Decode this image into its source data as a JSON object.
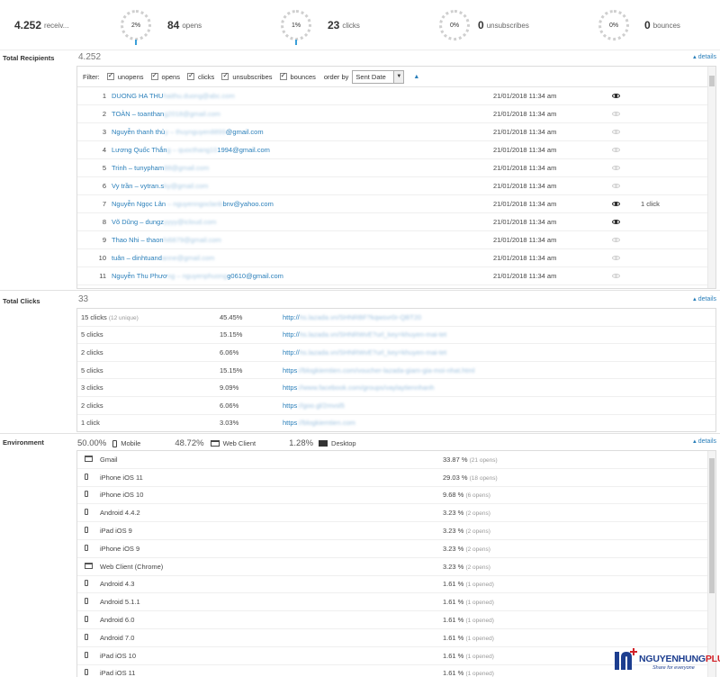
{
  "stats": {
    "receivers": {
      "value": "4.252",
      "label": "receiv..."
    },
    "opens": {
      "gauge": "2%",
      "value": "84",
      "label": "opens"
    },
    "clicks": {
      "gauge": "1%",
      "value": "23",
      "label": "clicks"
    },
    "unsubscribes": {
      "gauge": "0%",
      "value": "0",
      "label": "unsubscribes"
    },
    "bounces": {
      "gauge": "0%",
      "value": "0",
      "label": "bounces"
    }
  },
  "details_label": "details",
  "recipients": {
    "title": "Total Recipients",
    "count": "4.252",
    "filter_label": "Filter:",
    "filters": [
      "unopens",
      "opens",
      "clicks",
      "unsubscribes",
      "bounces"
    ],
    "order_by_label": "order by",
    "order_by_value": "Sent Date",
    "rows": [
      {
        "num": "1",
        "name": "DUONG HA THU",
        "email_hidden": "haithu.duong@abc.com",
        "email_visible": "",
        "date": "21/01/2018 11:34 am",
        "opened": true,
        "clicks": ""
      },
      {
        "num": "2",
        "name": "TOÀN – toanthan",
        "email_hidden": "g2018@gmail.com",
        "email_visible": "",
        "date": "21/01/2018 11:34 am",
        "opened": false,
        "clicks": ""
      },
      {
        "num": "3",
        "name": "Nguyễn thanh thủ",
        "email_hidden": "y – thuynguyen8899",
        "email_visible": "@gmail.com",
        "date": "21/01/2018 11:34 am",
        "opened": false,
        "clicks": ""
      },
      {
        "num": "4",
        "name": "Lương Quốc Thắn",
        "email_hidden": "g – quocthang10",
        "email_visible": "1994@gmail.com",
        "date": "21/01/2018 11:34 am",
        "opened": false,
        "clicks": ""
      },
      {
        "num": "5",
        "name": "Trinh – tunypham",
        "email_hidden": "88@gmail.com",
        "email_visible": "",
        "date": "21/01/2018 11:34 am",
        "opened": false,
        "clicks": ""
      },
      {
        "num": "6",
        "name": "Vy trần – vytran.s",
        "email_hidden": "ky@gmail.com",
        "email_visible": "",
        "date": "21/01/2018 11:34 am",
        "opened": false,
        "clicks": ""
      },
      {
        "num": "7",
        "name": "Nguyễn Ngọc Lân",
        "email_hidden": " – nguyenngoclanb",
        "email_visible": "bnv@yahoo.com",
        "date": "21/01/2018 11:34 am",
        "opened": true,
        "clicks": "1 click"
      },
      {
        "num": "8",
        "name": "Võ Dũng – dungz",
        "email_hidden": "yyyy@icloud.com",
        "email_visible": "",
        "date": "21/01/2018 11:34 am",
        "opened": true,
        "clicks": ""
      },
      {
        "num": "9",
        "name": "Thao Nhi – thaon",
        "email_hidden": "hi6879@gmail.com",
        "email_visible": "",
        "date": "21/01/2018 11:34 am",
        "opened": false,
        "clicks": ""
      },
      {
        "num": "10",
        "name": "tuân – dinhtuand",
        "email_hidden": "anne@gmail.com",
        "email_visible": "",
        "date": "21/01/2018 11:34 am",
        "opened": false,
        "clicks": ""
      },
      {
        "num": "11",
        "name": "Nguyễn Thu Phươ",
        "email_hidden": "ng – nguyenphuong",
        "email_visible": "g0610@gmail.com",
        "date": "21/01/2018 11:34 am",
        "opened": false,
        "clicks": ""
      }
    ]
  },
  "total_clicks": {
    "title": "Total Clicks",
    "count": "33",
    "rows": [
      {
        "clicks": "15 clicks",
        "unique": "(12 unique)",
        "pct": "45.45%",
        "url_visible": "http://",
        "url_hidden": "hs.lazada.vn/SHNRBF?kqwsvr0r-QBT20"
      },
      {
        "clicks": "5 clicks",
        "unique": "",
        "pct": "15.15%",
        "url_visible": "http://",
        "url_hidden": "hs.lazada.vn/SHNRWvE?url_key=khuyen-mai-tet"
      },
      {
        "clicks": "2 clicks",
        "unique": "",
        "pct": "6.06%",
        "url_visible": "http://",
        "url_hidden": "hs.lazada.vn/SHNRWvE?url_key=khuyen-mai-tet"
      },
      {
        "clicks": "5 clicks",
        "unique": "",
        "pct": "15.15%",
        "url_visible": "https",
        "url_hidden": "://blogkiemtien.com/voucher-lazada-giam-gia-moi-nhat.html"
      },
      {
        "clicks": "3 clicks",
        "unique": "",
        "pct": "9.09%",
        "url_visible": "https",
        "url_hidden": "://www.facebook.com/groups/vaylaytiennhanh"
      },
      {
        "clicks": "2 clicks",
        "unique": "",
        "pct": "6.06%",
        "url_visible": "https",
        "url_hidden": "://goo.gl/2mvsl5"
      },
      {
        "clicks": "1 click",
        "unique": "",
        "pct": "3.03%",
        "url_visible": "https",
        "url_hidden": "://blogkiemtien.com"
      }
    ]
  },
  "environment": {
    "title": "Environment",
    "summary": [
      {
        "pct": "50.00%",
        "label": "Mobile",
        "icon": "mobile-icon"
      },
      {
        "pct": "48.72%",
        "label": "Web Client",
        "icon": "window-icon"
      },
      {
        "pct": "1.28%",
        "label": "Desktop",
        "icon": "desktop-icon"
      }
    ],
    "rows": [
      {
        "icon": "window",
        "name": "Gmail",
        "pct": "33.87 %",
        "opens": "(21 opens)"
      },
      {
        "icon": "phone",
        "name": "iPhone iOS 11",
        "pct": "29.03 %",
        "opens": "(18 opens)"
      },
      {
        "icon": "phone",
        "name": "iPhone iOS 10",
        "pct": "9.68 %",
        "opens": "(6 opens)"
      },
      {
        "icon": "phone",
        "name": "Android 4.4.2",
        "pct": "3.23 %",
        "opens": "(2 opens)"
      },
      {
        "icon": "phone",
        "name": "iPad iOS 9",
        "pct": "3.23 %",
        "opens": "(2 opens)"
      },
      {
        "icon": "phone",
        "name": "iPhone iOS 9",
        "pct": "3.23 %",
        "opens": "(2 opens)"
      },
      {
        "icon": "window",
        "name": "Web Client (Chrome)",
        "pct": "3.23 %",
        "opens": "(2 opens)"
      },
      {
        "icon": "phone",
        "name": "Android 4.3",
        "pct": "1.61 %",
        "opens": "(1 opened)"
      },
      {
        "icon": "phone",
        "name": "Android 5.1.1",
        "pct": "1.61 %",
        "opens": "(1 opened)"
      },
      {
        "icon": "phone",
        "name": "Android 6.0",
        "pct": "1.61 %",
        "opens": "(1 opened)"
      },
      {
        "icon": "phone",
        "name": "Android 7.0",
        "pct": "1.61 %",
        "opens": "(1 opened)"
      },
      {
        "icon": "phone",
        "name": "iPad iOS 10",
        "pct": "1.61 %",
        "opens": "(1 opened)"
      },
      {
        "icon": "phone",
        "name": "iPad iOS 11",
        "pct": "1.61 %",
        "opens": "(1 opened)"
      }
    ]
  },
  "watermark": {
    "brand": "NGUYENHUNG",
    "brand_plus": "PLUS",
    "tagline": "Share for everyone"
  },
  "colors": {
    "link": "#2a7fba",
    "gauge_accent": "#3b9fd8",
    "logo_blue": "#1d3e8f",
    "logo_red": "#d22027"
  }
}
